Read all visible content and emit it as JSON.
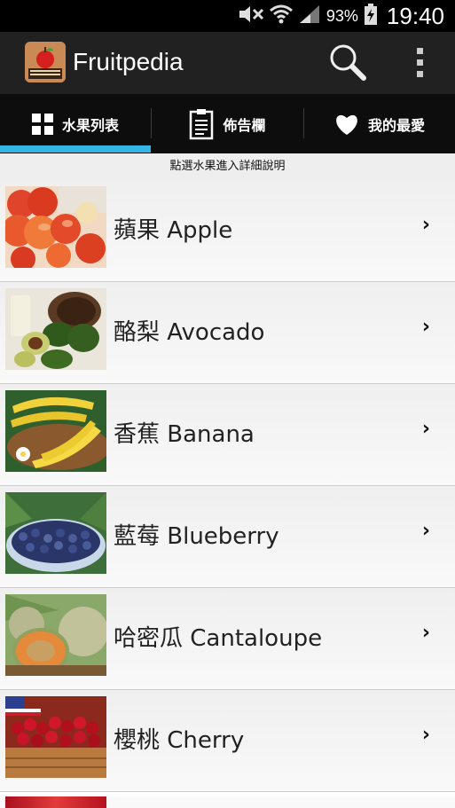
{
  "status_bar": {
    "battery_percent": "93%",
    "time": "19:40"
  },
  "app": {
    "title": "Fruitpedia"
  },
  "tabs": [
    {
      "label": "水果列表",
      "icon": "grid-icon",
      "selected": true
    },
    {
      "label": "佈告欄",
      "icon": "clipboard-icon",
      "selected": false
    },
    {
      "label": "我的最愛",
      "icon": "heart-icon",
      "selected": false
    }
  ],
  "hint": "點選水果進入詳細說明",
  "fruits": [
    {
      "label": "蘋果 Apple",
      "chevron": "›"
    },
    {
      "label": "酪梨 Avocado",
      "chevron": "›"
    },
    {
      "label": "香蕉 Banana",
      "chevron": "›"
    },
    {
      "label": "藍莓 Blueberry",
      "chevron": "›"
    },
    {
      "label": "哈密瓜 Cantaloupe",
      "chevron": "›"
    },
    {
      "label": "櫻桃 Cherry",
      "chevron": "›"
    }
  ],
  "colors": {
    "accent": "#33b5e5",
    "action_bar": "#212121",
    "tab_bar": "#0d0d0d"
  }
}
